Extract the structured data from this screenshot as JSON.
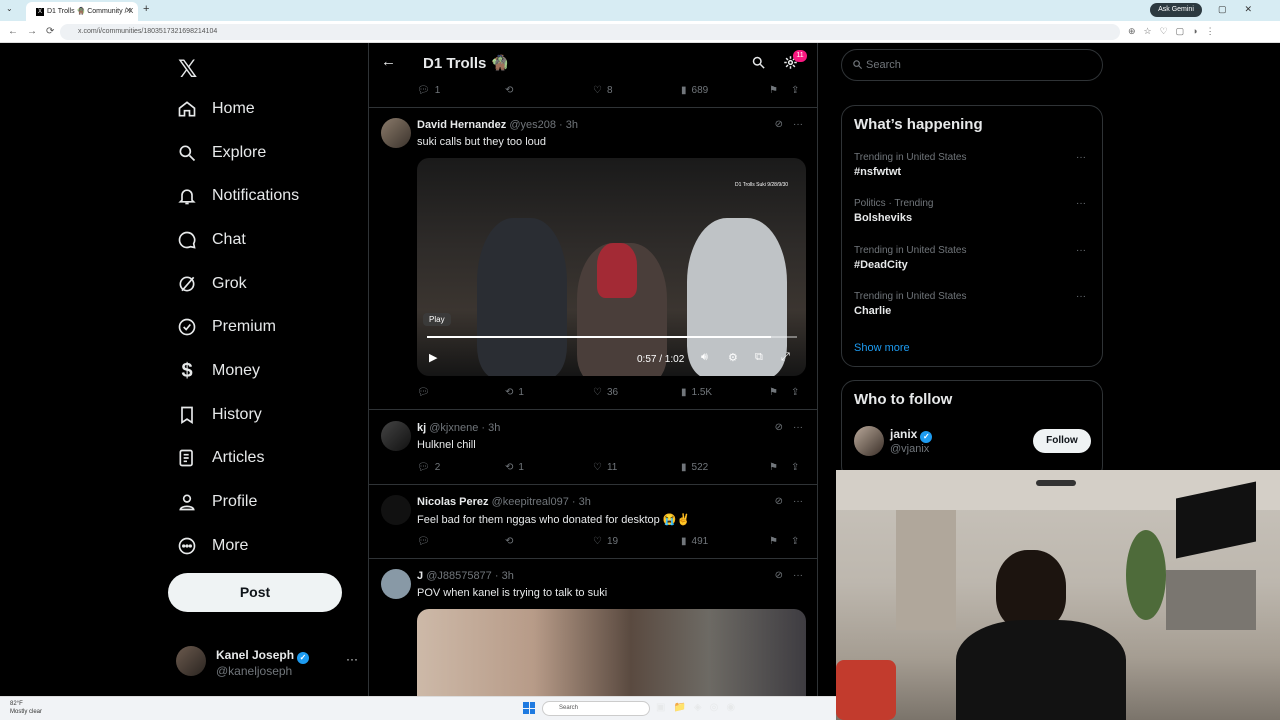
{
  "browser": {
    "tab_title": "D1 Trolls 🧌 Community / X",
    "url": "x.com/i/communities/1803517321698214104",
    "ask_gemini": "Ask Gemini"
  },
  "nav": {
    "items": [
      {
        "label": "Home",
        "icon": "home-icon"
      },
      {
        "label": "Explore",
        "icon": "search-icon"
      },
      {
        "label": "Notifications",
        "icon": "bell-icon"
      },
      {
        "label": "Chat",
        "icon": "chat-icon"
      },
      {
        "label": "Grok",
        "icon": "grok-icon"
      },
      {
        "label": "Premium",
        "icon": "premium-icon"
      },
      {
        "label": "Money",
        "icon": "money-icon"
      },
      {
        "label": "History",
        "icon": "bookmark-icon"
      },
      {
        "label": "Articles",
        "icon": "articles-icon"
      },
      {
        "label": "Profile",
        "icon": "person-icon"
      },
      {
        "label": "More",
        "icon": "more-circle-icon"
      }
    ],
    "post_label": "Post",
    "account": {
      "name": "Kanel Joseph",
      "handle": "@kaneljoseph",
      "more": "···"
    }
  },
  "feed": {
    "title": "D1 Trolls 🧌",
    "notif_count": "11",
    "top_actions": {
      "replies": "1",
      "retweets": "",
      "likes": "8",
      "views": "689"
    },
    "tweets": [
      {
        "name": "David Hernandez",
        "handle": "@yes208",
        "time": "· 3h",
        "text": "suki calls but they too loud",
        "video": {
          "play_badge": "Play",
          "time": "0:57 / 1:02",
          "overlay_text": "D1 Trolls Suki 9/28/9/30",
          "progress": 0.93
        },
        "replies": "",
        "retweets": "1",
        "likes": "36",
        "views": "1.5K"
      },
      {
        "name": "kj",
        "handle": "@kjxnene",
        "time": "· 3h",
        "text": "Hulknel chill",
        "replies": "2",
        "retweets": "1",
        "likes": "11",
        "views": "522"
      },
      {
        "name": "Nicolas Perez",
        "handle": "@keepitreal097",
        "time": "· 3h",
        "text": "Feel bad for them nggas who donated for desktop 😭✌️",
        "replies": "",
        "retweets": "",
        "likes": "19",
        "views": "491"
      },
      {
        "name": "J",
        "handle": "@J88575877",
        "time": "· 3h",
        "text": "POV when kanel is trying to talk to suki"
      }
    ]
  },
  "right": {
    "search_placeholder": "Search",
    "whats_happening": "What’s happening",
    "trends": [
      {
        "context": "Trending in United States",
        "name": "#nsfwtwt"
      },
      {
        "context": "Politics · Trending",
        "name": "Bolsheviks"
      },
      {
        "context": "Trending in United States",
        "name": "#DeadCity"
      },
      {
        "context": "Trending in United States",
        "name": "Charlie"
      }
    ],
    "show_more": "Show more",
    "who_to_follow": "Who to follow",
    "suggest": {
      "name": "janix",
      "handle": "@vjanix",
      "follow_label": "Follow"
    }
  },
  "taskbar": {
    "weather_temp": "82°F",
    "weather_desc": "Mostly clear",
    "search_label": "Search"
  },
  "colors": {
    "accent": "#1d9bf0",
    "bg": "#000000",
    "border": "#2f3336",
    "muted": "#71767b"
  }
}
